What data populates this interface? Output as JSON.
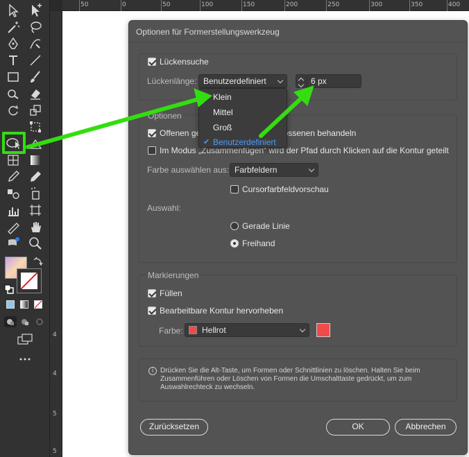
{
  "ruler": {
    "top_ticks": [
      "50",
      "0",
      "50",
      "100",
      "150",
      "200",
      "250",
      "300",
      "350",
      "400"
    ],
    "left_ticks": [
      "4",
      "4",
      "5",
      "5"
    ]
  },
  "dialog": {
    "title": "Optionen für Formerstellungswerkzeug",
    "gap": {
      "checkbox_label": "Lückensuche",
      "length_label": "Lückenlänge:",
      "length_select": "Benutzerdefiniert",
      "length_value": "6 px",
      "dropdown_options": [
        "Klein",
        "Mittel",
        "Groß",
        "Benutzerdefiniert"
      ],
      "dropdown_selected": "Benutzerdefiniert"
    },
    "options": {
      "section_label": "Optionen",
      "open_paths_label": "Offenen gefüllten Pfad wie geschlossenen behandeln",
      "merge_mode_label": "Im Modus „Zusammenfügen“ wird der Pfad durch Klicken auf die Kontur geteilt",
      "color_from_label": "Farbe auswählen aus:",
      "color_from_value": "Farbfeldern",
      "cursor_preview_label": "Cursorfarbfeldvorschau",
      "selection_label": "Auswahl:",
      "straight_line_label": "Gerade Linie",
      "freehand_label": "Freihand"
    },
    "highlights": {
      "section_label": "Markierungen",
      "fill_label": "Füllen",
      "editable_stroke_label": "Bearbeitbare Kontur hervorheben",
      "color_label": "Farbe:",
      "color_value": "Hellrot",
      "color_hex": "#f04a4a"
    },
    "info": {
      "text": "Drücken Sie die Alt-Taste, um Formen oder Schnittlinien zu löschen. Halten Sie beim Zusammenführen oder Löschen von Formen die Umschalttaste gedrückt, um zum Auswahlrechteck zu wechseln."
    },
    "buttons": {
      "reset": "Zurücksetzen",
      "ok": "OK",
      "cancel": "Abbrechen"
    }
  },
  "colors": {
    "annotation_green": "#33dd11",
    "dialog_bg": "#535353",
    "toolbar_bg": "#323232"
  }
}
